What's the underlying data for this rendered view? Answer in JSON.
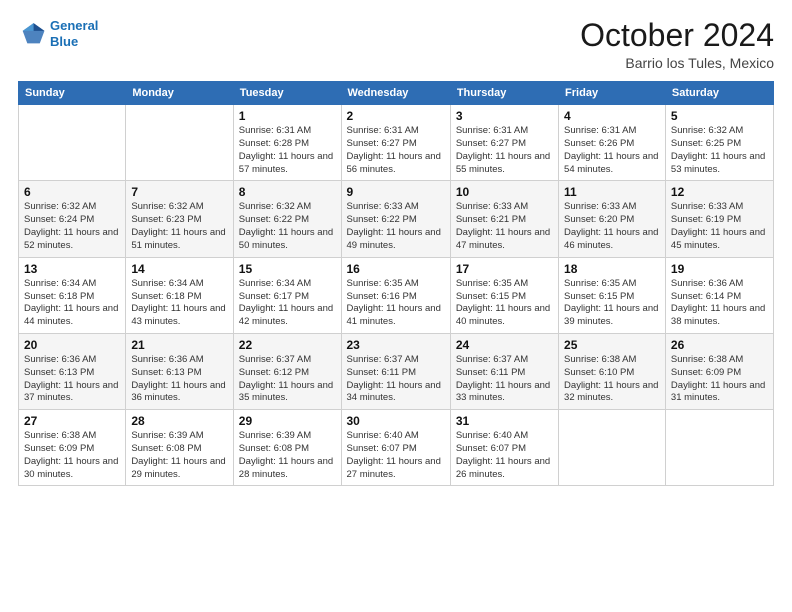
{
  "header": {
    "logo_line1": "General",
    "logo_line2": "Blue",
    "month": "October 2024",
    "location": "Barrio los Tules, Mexico"
  },
  "days_of_week": [
    "Sunday",
    "Monday",
    "Tuesday",
    "Wednesday",
    "Thursday",
    "Friday",
    "Saturday"
  ],
  "weeks": [
    [
      {
        "day": "",
        "info": ""
      },
      {
        "day": "",
        "info": ""
      },
      {
        "day": "1",
        "info": "Sunrise: 6:31 AM\nSunset: 6:28 PM\nDaylight: 11 hours and 57 minutes."
      },
      {
        "day": "2",
        "info": "Sunrise: 6:31 AM\nSunset: 6:27 PM\nDaylight: 11 hours and 56 minutes."
      },
      {
        "day": "3",
        "info": "Sunrise: 6:31 AM\nSunset: 6:27 PM\nDaylight: 11 hours and 55 minutes."
      },
      {
        "day": "4",
        "info": "Sunrise: 6:31 AM\nSunset: 6:26 PM\nDaylight: 11 hours and 54 minutes."
      },
      {
        "day": "5",
        "info": "Sunrise: 6:32 AM\nSunset: 6:25 PM\nDaylight: 11 hours and 53 minutes."
      }
    ],
    [
      {
        "day": "6",
        "info": "Sunrise: 6:32 AM\nSunset: 6:24 PM\nDaylight: 11 hours and 52 minutes."
      },
      {
        "day": "7",
        "info": "Sunrise: 6:32 AM\nSunset: 6:23 PM\nDaylight: 11 hours and 51 minutes."
      },
      {
        "day": "8",
        "info": "Sunrise: 6:32 AM\nSunset: 6:22 PM\nDaylight: 11 hours and 50 minutes."
      },
      {
        "day": "9",
        "info": "Sunrise: 6:33 AM\nSunset: 6:22 PM\nDaylight: 11 hours and 49 minutes."
      },
      {
        "day": "10",
        "info": "Sunrise: 6:33 AM\nSunset: 6:21 PM\nDaylight: 11 hours and 47 minutes."
      },
      {
        "day": "11",
        "info": "Sunrise: 6:33 AM\nSunset: 6:20 PM\nDaylight: 11 hours and 46 minutes."
      },
      {
        "day": "12",
        "info": "Sunrise: 6:33 AM\nSunset: 6:19 PM\nDaylight: 11 hours and 45 minutes."
      }
    ],
    [
      {
        "day": "13",
        "info": "Sunrise: 6:34 AM\nSunset: 6:18 PM\nDaylight: 11 hours and 44 minutes."
      },
      {
        "day": "14",
        "info": "Sunrise: 6:34 AM\nSunset: 6:18 PM\nDaylight: 11 hours and 43 minutes."
      },
      {
        "day": "15",
        "info": "Sunrise: 6:34 AM\nSunset: 6:17 PM\nDaylight: 11 hours and 42 minutes."
      },
      {
        "day": "16",
        "info": "Sunrise: 6:35 AM\nSunset: 6:16 PM\nDaylight: 11 hours and 41 minutes."
      },
      {
        "day": "17",
        "info": "Sunrise: 6:35 AM\nSunset: 6:15 PM\nDaylight: 11 hours and 40 minutes."
      },
      {
        "day": "18",
        "info": "Sunrise: 6:35 AM\nSunset: 6:15 PM\nDaylight: 11 hours and 39 minutes."
      },
      {
        "day": "19",
        "info": "Sunrise: 6:36 AM\nSunset: 6:14 PM\nDaylight: 11 hours and 38 minutes."
      }
    ],
    [
      {
        "day": "20",
        "info": "Sunrise: 6:36 AM\nSunset: 6:13 PM\nDaylight: 11 hours and 37 minutes."
      },
      {
        "day": "21",
        "info": "Sunrise: 6:36 AM\nSunset: 6:13 PM\nDaylight: 11 hours and 36 minutes."
      },
      {
        "day": "22",
        "info": "Sunrise: 6:37 AM\nSunset: 6:12 PM\nDaylight: 11 hours and 35 minutes."
      },
      {
        "day": "23",
        "info": "Sunrise: 6:37 AM\nSunset: 6:11 PM\nDaylight: 11 hours and 34 minutes."
      },
      {
        "day": "24",
        "info": "Sunrise: 6:37 AM\nSunset: 6:11 PM\nDaylight: 11 hours and 33 minutes."
      },
      {
        "day": "25",
        "info": "Sunrise: 6:38 AM\nSunset: 6:10 PM\nDaylight: 11 hours and 32 minutes."
      },
      {
        "day": "26",
        "info": "Sunrise: 6:38 AM\nSunset: 6:09 PM\nDaylight: 11 hours and 31 minutes."
      }
    ],
    [
      {
        "day": "27",
        "info": "Sunrise: 6:38 AM\nSunset: 6:09 PM\nDaylight: 11 hours and 30 minutes."
      },
      {
        "day": "28",
        "info": "Sunrise: 6:39 AM\nSunset: 6:08 PM\nDaylight: 11 hours and 29 minutes."
      },
      {
        "day": "29",
        "info": "Sunrise: 6:39 AM\nSunset: 6:08 PM\nDaylight: 11 hours and 28 minutes."
      },
      {
        "day": "30",
        "info": "Sunrise: 6:40 AM\nSunset: 6:07 PM\nDaylight: 11 hours and 27 minutes."
      },
      {
        "day": "31",
        "info": "Sunrise: 6:40 AM\nSunset: 6:07 PM\nDaylight: 11 hours and 26 minutes."
      },
      {
        "day": "",
        "info": ""
      },
      {
        "day": "",
        "info": ""
      }
    ]
  ]
}
